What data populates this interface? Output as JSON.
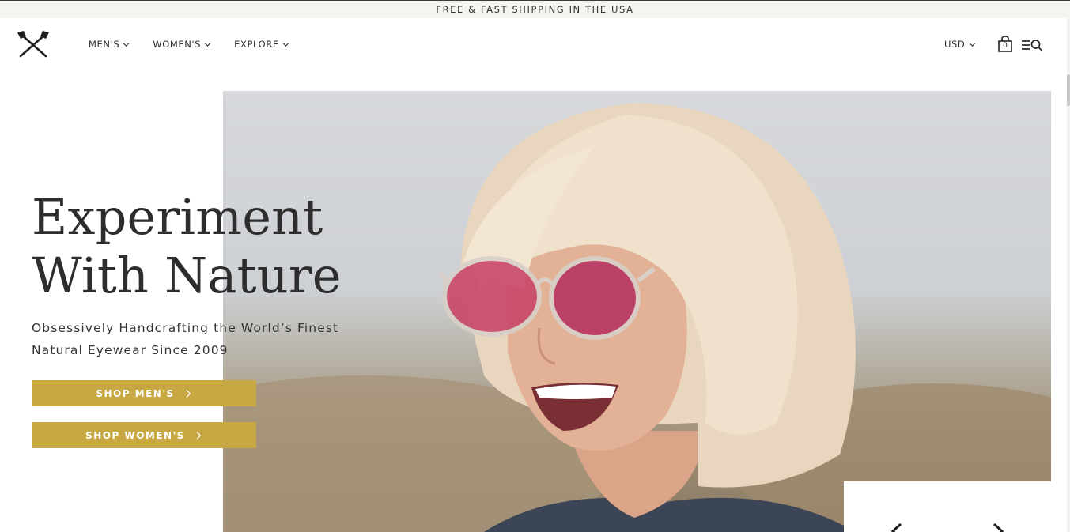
{
  "announcement": {
    "text": "FREE & FAST SHIPPING IN THE USA"
  },
  "header": {
    "logo_icon": "crossed-axes-icon",
    "nav": [
      {
        "label": "MEN'S",
        "icon": "chevron-down-icon"
      },
      {
        "label": "WOMEN'S",
        "icon": "chevron-down-icon"
      },
      {
        "label": "EXPLORE",
        "icon": "chevron-down-icon"
      }
    ],
    "currency": {
      "label": "USD",
      "icon": "chevron-down-icon"
    },
    "cart": {
      "count": "0",
      "icon": "shopping-bag-icon"
    },
    "menu_search_icon": "menu-search-icon"
  },
  "hero": {
    "headline_line1": "Experiment",
    "headline_line2": "With Nature",
    "subhead_line1": "Obsessively Handcrafting the World’s Finest",
    "subhead_line2": "Natural Eyewear Since 2009",
    "buttons": [
      {
        "label": "SHOP MEN'S",
        "icon": "chevron-right-icon"
      },
      {
        "label": "SHOP WOMEN'S",
        "icon": "chevron-right-icon"
      }
    ],
    "image_description_icon": "hero-photo"
  },
  "slider": {
    "prev_icon": "chevron-left-icon",
    "next_icon": "chevron-right-icon"
  },
  "colors": {
    "accent": "#c8a842",
    "text": "#2d2d2d",
    "announcement_bg": "#f5f5ef"
  }
}
